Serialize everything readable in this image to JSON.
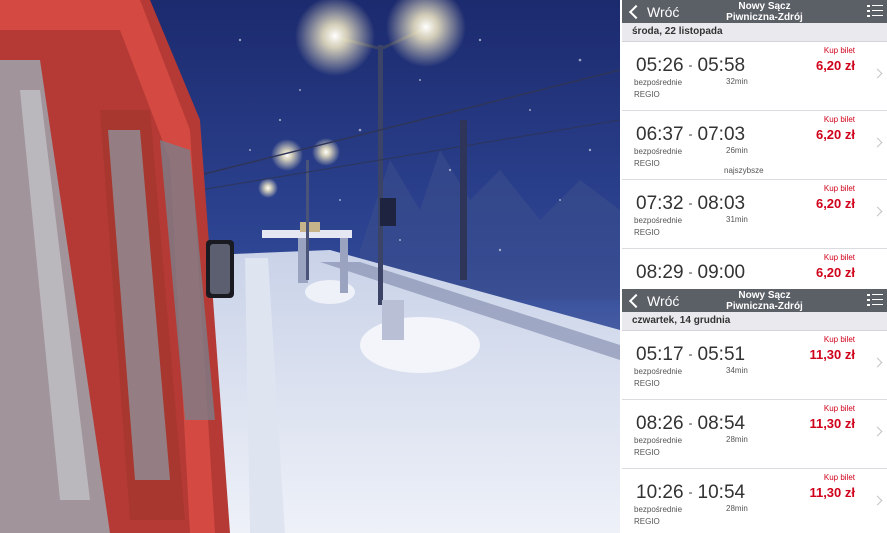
{
  "panels": [
    {
      "back_label": "Wróć",
      "title_line1": "Nowy Sącz",
      "title_line2": "Piwniczna-Zdrój",
      "date": "środa, 22 listopada",
      "connections": [
        {
          "dep": "05:26",
          "arr": "05:58",
          "type": "bezpośrednie",
          "category": "REGIO",
          "duration": "32min",
          "note": "",
          "buy": "Kup bilet",
          "price": "6,20 zł"
        },
        {
          "dep": "06:37",
          "arr": "07:03",
          "type": "bezpośrednie",
          "category": "REGIO",
          "duration": "26min",
          "note": "najszybsze",
          "buy": "Kup bilet",
          "price": "6,20 zł"
        },
        {
          "dep": "07:32",
          "arr": "08:03",
          "type": "bezpośrednie",
          "category": "REGIO",
          "duration": "31min",
          "note": "",
          "buy": "Kup bilet",
          "price": "6,20 zł"
        },
        {
          "dep": "08:29",
          "arr": "09:00",
          "type": "",
          "category": "",
          "duration": "",
          "note": "",
          "buy": "Kup bilet",
          "price": "6,20 zł"
        }
      ]
    },
    {
      "back_label": "Wróć",
      "title_line1": "Nowy Sącz",
      "title_line2": "Piwniczna-Zdrój",
      "date": "czwartek, 14 grudnia",
      "connections": [
        {
          "dep": "05:17",
          "arr": "05:51",
          "type": "bezpośrednie",
          "category": "REGIO",
          "duration": "34min",
          "note": "",
          "buy": "Kup bilet",
          "price": "11,30 zł"
        },
        {
          "dep": "08:26",
          "arr": "08:54",
          "type": "bezpośrednie",
          "category": "REGIO",
          "duration": "28min",
          "note": "",
          "buy": "Kup bilet",
          "price": "11,30 zł"
        },
        {
          "dep": "10:26",
          "arr": "10:54",
          "type": "bezpośrednie",
          "category": "REGIO",
          "duration": "28min",
          "note": "",
          "buy": "Kup bilet",
          "price": "11,30 zł"
        }
      ]
    }
  ],
  "colors": {
    "navbar": "#5b5f66",
    "price": "#d0021b",
    "background": "#f2f2f5"
  },
  "icons": {
    "back": "chevron-left-icon",
    "menu": "list-menu-icon",
    "row": "chevron-right-icon"
  }
}
